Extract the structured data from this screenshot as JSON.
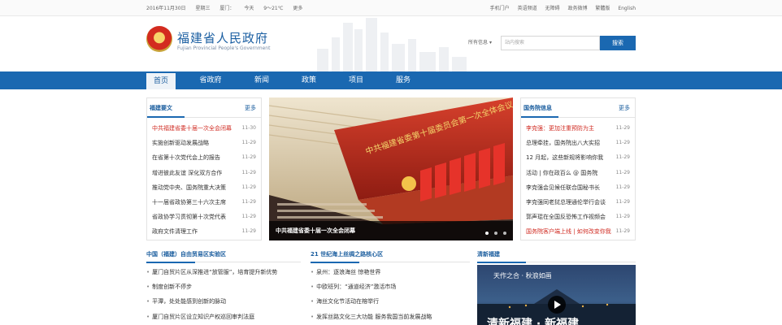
{
  "topbar": {
    "date": "2016年11月30日",
    "weekday": "星期三",
    "city": "厦门：",
    "weather": "今天",
    "temp": "9～21℃",
    "weather_link": "更多",
    "links": [
      "手机门户",
      "英语频道",
      "无障碍",
      "政务微博",
      "繁體版",
      "English"
    ]
  },
  "header": {
    "title": "福建省人民政府",
    "subtitle": "Fujian Provincial People's Government",
    "search_scope": "所有信息",
    "search_placeholder": "站内搜索",
    "search_button": "搜索"
  },
  "nav": [
    "首页",
    "省政府",
    "新闻",
    "政策",
    "项目",
    "服务"
  ],
  "fujian_news": {
    "title": "福建要文",
    "more": "更多",
    "items": [
      {
        "text": "中共福建省委十届一次全会闭幕",
        "date": "11-30"
      },
      {
        "text": "实施创新驱动发展战略",
        "date": "11-29"
      },
      {
        "text": "在省第十次党代会上的报告",
        "date": "11-29"
      },
      {
        "text": "增进彼此友谊 深化双方合作",
        "date": "11-29"
      },
      {
        "text": "推动党中央、国务院重大决策",
        "date": "11-29"
      },
      {
        "text": "十一届省政协第三十六次主席",
        "date": "11-29"
      },
      {
        "text": "省政协学习贯彻第十次党代表",
        "date": "11-29"
      },
      {
        "text": "政府文件清理工作",
        "date": "11-29"
      }
    ]
  },
  "slide": {
    "caption": "中共福建省委十届一次全会闭幕",
    "banner": "中共福建省委第十届委员会第一次全体会议"
  },
  "state_council": {
    "title": "国务院信息",
    "more": "更多",
    "items": [
      {
        "text": "李克强：更加注重预防为主",
        "date": "11-29",
        "red": true
      },
      {
        "text": "总理牵挂，国务院出八大实招",
        "date": "11-29"
      },
      {
        "text": "12 月起，这些新规将影响你我",
        "date": "11-29"
      },
      {
        "text": "活动 | 你在政百么 @ 国务院",
        "date": "11-29"
      },
      {
        "text": "李克强会见候任联合国秘书长",
        "date": "11-29"
      },
      {
        "text": "李克强同老挝总理通伦举行会谈",
        "date": "11-29"
      },
      {
        "text": "郭声琨在全国反恐怖工作视频会",
        "date": "11-29"
      },
      {
        "text": "国务院客户端上线 | 如何改变你我",
        "date": "11-29",
        "red": true
      }
    ]
  },
  "ftz": {
    "title": "中国（福建）自由贸易区实验区",
    "items": [
      "厦门自贸片区从深推进“放管服”，培育提升新优势",
      "制度创新不停步",
      "平潭，处处能感到创新的脉动",
      "厦门自贸片区设立知识产权巡回审判法庭"
    ]
  },
  "silk_road": {
    "title": "21 世纪海上丝绸之路核心区",
    "items": [
      "泉州：逐浪海丝  惊艳世界",
      "中欧班列：“通道经济”激活市场",
      "海丝文化节活动在榕举行",
      "发挥丝路文化三大功能 服务我国当前发展战略"
    ]
  },
  "clean_fujian": {
    "title": "清新福建",
    "video_text": "天作之合 · 秋浪如画",
    "video_banner": "清新福建 · 新福建"
  }
}
